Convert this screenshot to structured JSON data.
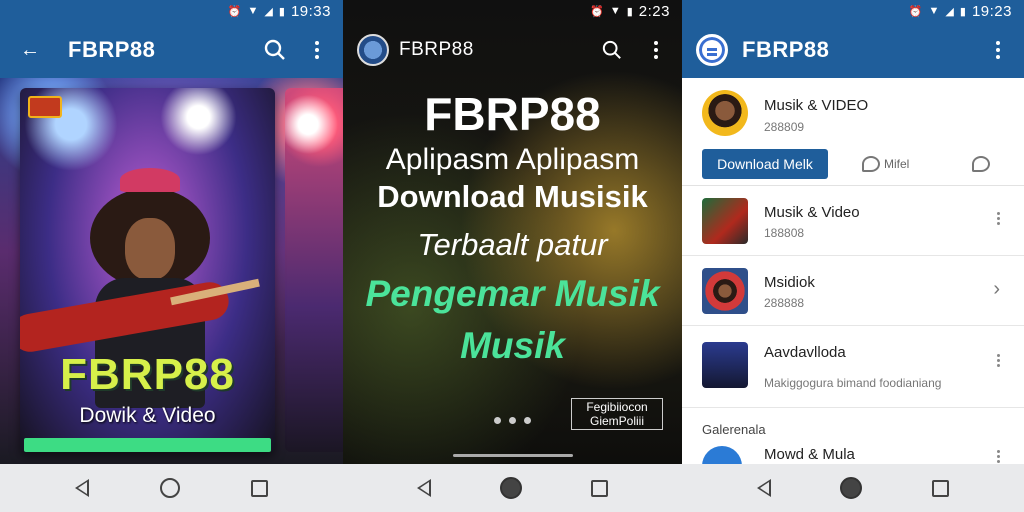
{
  "status": {
    "panel1_time": "19:33",
    "panel2_time": "2:23",
    "panel3_time": "19:23"
  },
  "panel1": {
    "app_title": "FBRP88",
    "card_brand": "FBRP88",
    "card_subtitle": "Dowik & Video"
  },
  "panel2": {
    "app_title": "FBRP88",
    "hero_title": "FBRP88",
    "hero_line1": "Aplipasm Aplipasm",
    "hero_line2": "Download Musisik",
    "hero_line3": "Terbaalt patur",
    "hero_line4": "Pengemar Musik",
    "hero_line5": "Musik",
    "watermark": "Fegibiiocon GiemPoliii"
  },
  "panel3": {
    "app_title": "FBRP88",
    "featured": {
      "title": "Musik & VIDEO",
      "sub": "288809",
      "download_label": "Download Melk",
      "chat1_label": "Mifel",
      "chat2_label": ""
    },
    "rows": [
      {
        "title": "Musik & Video",
        "sub": "188808"
      },
      {
        "title": "Msidiok",
        "sub": "288888"
      },
      {
        "title": "Aavdavlloda",
        "sub": "Makiggogura bimand foodianiang"
      }
    ],
    "section_label": "Galerenala",
    "partial_row_title": "Mowd & Mula"
  },
  "colors": {
    "appbar": "#1f5e9b",
    "accent_green": "#4be39a",
    "brand_yellow": "#d7f04a"
  }
}
